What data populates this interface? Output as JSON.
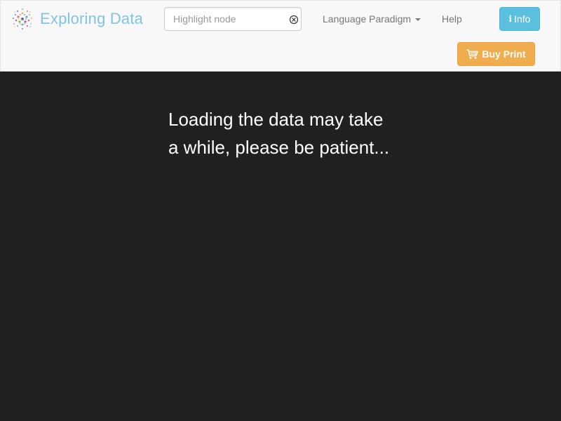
{
  "navbar": {
    "brand": {
      "title": "Exploring Data",
      "logo_icon": "network-dots-logo-icon"
    },
    "search": {
      "placeholder": "Highlight node",
      "value": "",
      "clear_icon": "circle-x-icon"
    },
    "menu": {
      "paradigm_label": "Language Paradigm",
      "help_label": "Help"
    },
    "info_button": {
      "glyph": "i",
      "label": "Info",
      "color": "#5bc0de"
    },
    "buy_button": {
      "label": "Buy Print",
      "icon": "shopping-cart-icon",
      "color": "#f0ad4e"
    }
  },
  "main": {
    "loading_message": "Loading the data may take a while, please be patient...",
    "background": "#202020"
  }
}
